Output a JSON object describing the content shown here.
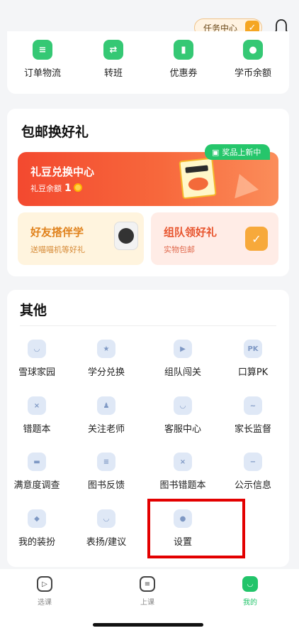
{
  "header": {
    "task_center_label": "任务中心",
    "task_check_glyph": "✓",
    "bell_icon": "bell-icon"
  },
  "account_row": {
    "items": [
      {
        "label": "订单物流",
        "icon": "order-icon",
        "color": "#35c874",
        "glyph": "≡"
      },
      {
        "label": "转班",
        "icon": "transfer-icon",
        "color": "#35c874",
        "glyph": "⇄"
      },
      {
        "label": "优惠券",
        "icon": "coupon-icon",
        "color": "#35c874",
        "glyph": "▮"
      },
      {
        "label": "学币余额",
        "icon": "coin-balance-icon",
        "color": "#35c874",
        "glyph": "●"
      }
    ]
  },
  "gifts": {
    "title": "包邮换好礼",
    "banner": {
      "title": "礼豆兑换中心",
      "balance_label": "礼豆余额",
      "balance_value": "1",
      "new_badge": "奖品上新中"
    },
    "friend_card": {
      "title": "好友搭伴学",
      "subtitle": "送喵喵机等好礼"
    },
    "team_card": {
      "title": "组队领好礼",
      "subtitle": "实物包邮"
    }
  },
  "other": {
    "title": "其他",
    "items": [
      {
        "label": "雪球家园",
        "icon": "snowball-home-icon",
        "glyph": "◡"
      },
      {
        "label": "学分兑换",
        "icon": "credit-exchange-icon",
        "glyph": "★"
      },
      {
        "label": "组队闯关",
        "icon": "team-challenge-icon",
        "glyph": "▶"
      },
      {
        "label": "口算PK",
        "icon": "mental-math-pk-icon",
        "glyph": "PK"
      },
      {
        "label": "错题本",
        "icon": "wrong-questions-icon",
        "glyph": "×"
      },
      {
        "label": "关注老师",
        "icon": "follow-teacher-icon",
        "glyph": "♟"
      },
      {
        "label": "客服中心",
        "icon": "customer-service-icon",
        "glyph": "◡"
      },
      {
        "label": "家长监督",
        "icon": "parent-monitor-icon",
        "glyph": "~"
      },
      {
        "label": "满意度调查",
        "icon": "survey-icon",
        "glyph": "▬"
      },
      {
        "label": "图书反馈",
        "icon": "book-feedback-icon",
        "glyph": "≡"
      },
      {
        "label": "图书错题本",
        "icon": "book-wrong-questions-icon",
        "glyph": "×"
      },
      {
        "label": "公示信息",
        "icon": "public-info-icon",
        "glyph": "−"
      },
      {
        "label": "我的装扮",
        "icon": "my-outfit-icon",
        "glyph": "◆"
      },
      {
        "label": "表扬/建议",
        "icon": "praise-suggest-icon",
        "glyph": "◡"
      },
      {
        "label": "设置",
        "icon": "settings-icon",
        "glyph": "●"
      }
    ]
  },
  "bottom_nav": {
    "items": [
      {
        "label": "选课",
        "icon": "course-select-icon",
        "glyph": "▷"
      },
      {
        "label": "上课",
        "icon": "class-icon",
        "glyph": "≡"
      },
      {
        "label": "我的",
        "icon": "profile-icon",
        "glyph": "◡"
      }
    ]
  }
}
